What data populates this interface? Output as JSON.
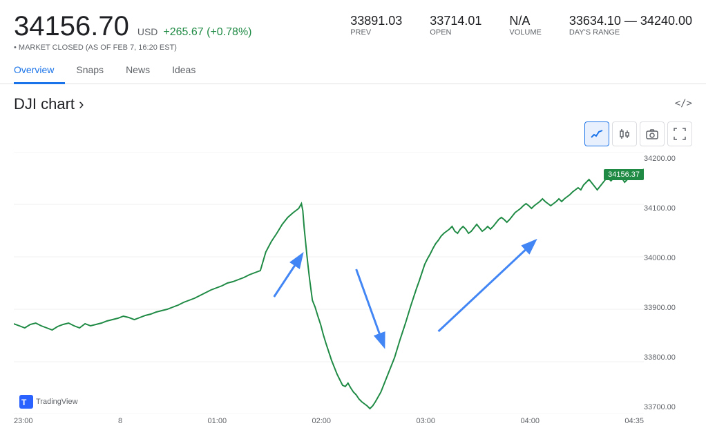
{
  "header": {
    "main_price": "34156.70",
    "currency": "USD",
    "change": "+265.67 (+0.78%)",
    "market_status": "• MARKET CLOSED (AS OF FEB 7, 16:20 EST)"
  },
  "stats": [
    {
      "label": "PREV",
      "value": "33891.03"
    },
    {
      "label": "OPEN",
      "value": "33714.01"
    },
    {
      "label": "VOLUME",
      "value": "N/A"
    },
    {
      "label": "DAY'S RANGE",
      "value": "33634.10 — 34240.00"
    }
  ],
  "tabs": [
    {
      "label": "Overview",
      "active": true
    },
    {
      "label": "Snaps",
      "active": false
    },
    {
      "label": "News",
      "active": false
    },
    {
      "label": "Ideas",
      "active": false
    }
  ],
  "chart": {
    "title": "DJI chart ›",
    "embed_label": "</>",
    "price_tag": "34156.37",
    "y_labels": [
      "34200.00",
      "34100.00",
      "34000.00",
      "33900.00",
      "33800.00",
      "33700.00"
    ],
    "x_labels": [
      "23:00",
      "8",
      "01:00",
      "02:00",
      "03:00",
      "04:00",
      "04:35"
    ],
    "tradingview_label": "TradingView"
  },
  "toolbar": {
    "buttons": [
      {
        "icon": "〜",
        "label": "line-chart",
        "active": true
      },
      {
        "icon": "⬆",
        "label": "candlestick",
        "active": false
      },
      {
        "icon": "📷",
        "label": "screenshot",
        "active": false
      },
      {
        "icon": "⛶",
        "label": "fullscreen",
        "active": false
      }
    ]
  }
}
